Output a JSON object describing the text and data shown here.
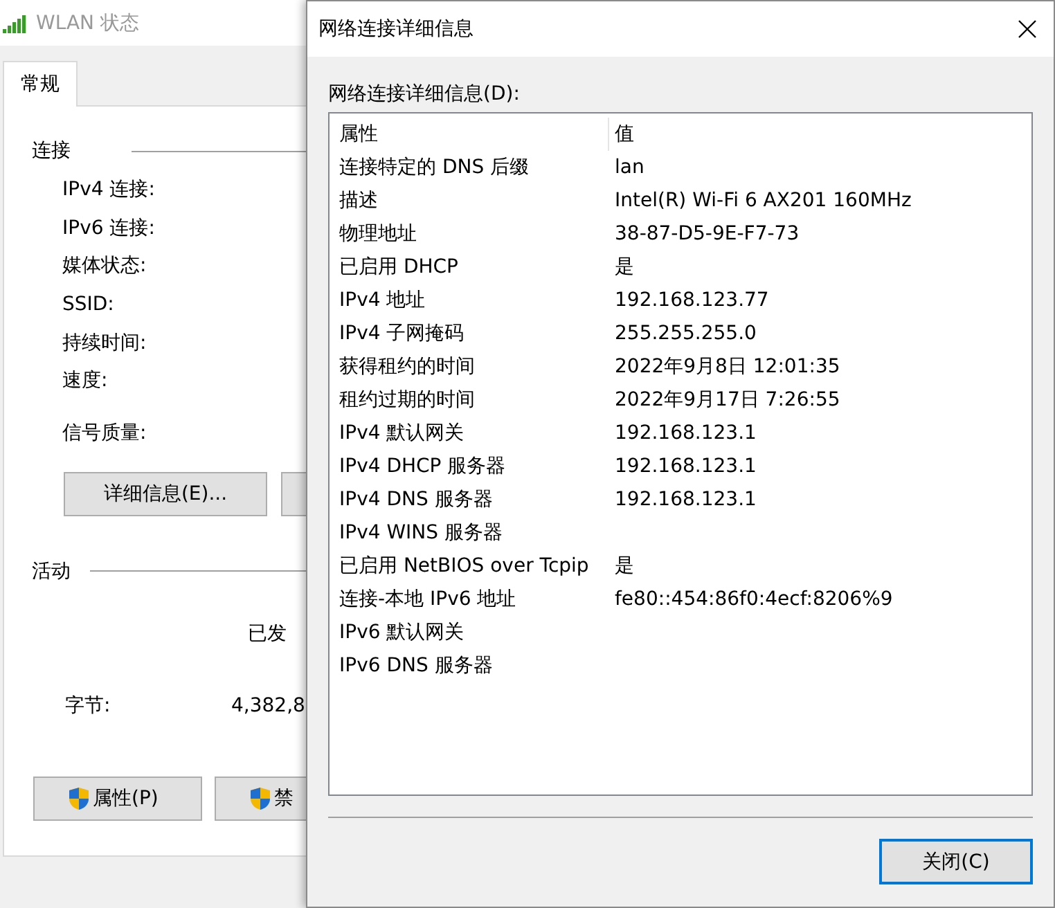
{
  "status_window": {
    "title": "WLAN 状态",
    "tabs": [
      {
        "label": "常规",
        "selected": true
      }
    ],
    "connection": {
      "label": "连接",
      "fields": [
        "IPv4 连接:",
        "IPv6 连接:",
        "媒体状态:",
        "SSID:",
        "持续时间:",
        "速度:",
        "信号质量:"
      ],
      "buttons": [
        {
          "label": "详细信息(E)..."
        }
      ]
    },
    "activity": {
      "label": "活动",
      "sent_header": "已发",
      "rows": [
        {
          "label": "字节:",
          "sent": "4,382,8"
        }
      ]
    },
    "buttons": [
      {
        "label": "属性(P)",
        "shield": true
      },
      {
        "label": "禁",
        "shield": true
      }
    ]
  },
  "details_dialog": {
    "title": "网络连接详细信息",
    "list_label": "网络连接详细信息(D):",
    "columns": [
      "属性",
      "值"
    ],
    "rows": [
      {
        "property": "连接特定的 DNS 后缀",
        "value": "lan"
      },
      {
        "property": "描述",
        "value": "Intel(R) Wi-Fi 6 AX201 160MHz"
      },
      {
        "property": "物理地址",
        "value": "38-87-D5-9E-F7-73"
      },
      {
        "property": "已启用 DHCP",
        "value": "是"
      },
      {
        "property": "IPv4 地址",
        "value": "192.168.123.77"
      },
      {
        "property": "IPv4 子网掩码",
        "value": "255.255.255.0"
      },
      {
        "property": "获得租约的时间",
        "value": "2022年9月8日 12:01:35"
      },
      {
        "property": "租约过期的时间",
        "value": "2022年9月17日 7:26:55"
      },
      {
        "property": "IPv4 默认网关",
        "value": "192.168.123.1"
      },
      {
        "property": "IPv4 DHCP 服务器",
        "value": "192.168.123.1"
      },
      {
        "property": "IPv4 DNS 服务器",
        "value": "192.168.123.1"
      },
      {
        "property": "IPv4 WINS 服务器"
      },
      {
        "property": "已启用 NetBIOS over Tcpip",
        "value": "是"
      },
      {
        "property": "连接-本地 IPv6 地址",
        "value": "fe80::454:86f0:4ecf:8206%9"
      },
      {
        "property": "IPv6 默认网关"
      },
      {
        "property": "IPv6 DNS 服务器"
      }
    ],
    "close_button": {
      "label": "关闭(C)",
      "default": true
    }
  }
}
